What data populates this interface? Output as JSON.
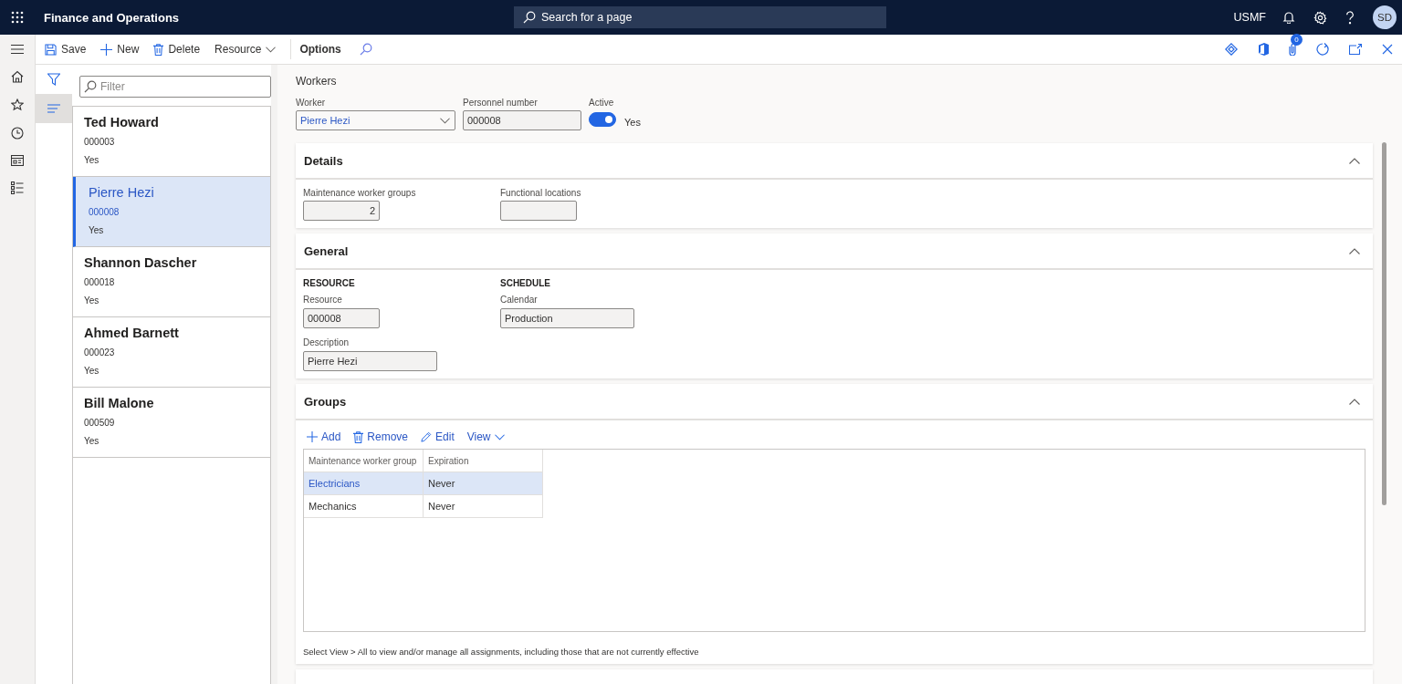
{
  "app": {
    "title": "Finance and Operations",
    "search_placeholder": "Search for a page",
    "company": "USMF",
    "avatar": "SD",
    "notification_count": "0"
  },
  "action_bar": [
    {
      "label": "Save",
      "kind": "save"
    },
    {
      "label": "New",
      "kind": "new"
    },
    {
      "label": "Delete",
      "kind": "delete"
    },
    {
      "label": "Resource",
      "kind": "menu"
    },
    {
      "label": "Options",
      "kind": "strong"
    },
    {
      "kind": "search"
    }
  ],
  "list": {
    "filter_placeholder": "Filter",
    "items": [
      {
        "name": "Ted Howard",
        "number": "000003",
        "active": "Yes",
        "selected": false
      },
      {
        "name": "Pierre Hezi",
        "number": "000008",
        "active": "Yes",
        "selected": true
      },
      {
        "name": "Shannon Dascher",
        "number": "000018",
        "active": "Yes",
        "selected": false
      },
      {
        "name": "Ahmed Barnett",
        "number": "000023",
        "active": "Yes",
        "selected": false
      },
      {
        "name": "Bill Malone",
        "number": "000509",
        "active": "Yes",
        "selected": false
      }
    ]
  },
  "header": {
    "title": "Workers",
    "worker": {
      "label": "Worker",
      "value": "Pierre Hezi"
    },
    "personnel_number": {
      "label": "Personnel number",
      "value": "000008"
    },
    "active": {
      "label": "Active",
      "on": true,
      "text": "Yes"
    }
  },
  "sections": [
    {
      "kind": "details",
      "title": "Details",
      "expanded": true,
      "fields": [
        {
          "label": "Maintenance worker groups",
          "value": "2",
          "kind": "number"
        },
        {
          "label": "Functional locations",
          "kind": "code"
        }
      ]
    },
    {
      "kind": "general",
      "title": "General",
      "expanded": true,
      "groups": [
        {
          "heading": "RESOURCE",
          "fields": [
            {
              "label": "Resource",
              "value": "000008",
              "kind": "code"
            },
            {
              "label": "Description",
              "value": "Pierre Hezi",
              "kind": "text"
            }
          ]
        },
        {
          "heading": "SCHEDULE",
          "fields": [
            {
              "label": "Calendar",
              "value": "Production",
              "kind": "text"
            }
          ]
        }
      ]
    },
    {
      "kind": "groups",
      "title": "Groups",
      "expanded": true,
      "toolbar": [
        {
          "label": "Add",
          "kind": "add"
        },
        {
          "label": "Remove",
          "kind": "delete"
        },
        {
          "label": "Edit",
          "kind": "edit"
        },
        {
          "label": "View",
          "kind": "menu"
        }
      ],
      "columns": [
        "Maintenance worker group",
        "Expiration"
      ],
      "rows": [
        {
          "cells": [
            "Electricians",
            "Never"
          ],
          "selected": true
        },
        {
          "cells": [
            "Mechanics",
            "Never"
          ],
          "selected": false
        }
      ],
      "note": "Select View > All to view and/or manage all assignments, including those that are not currently effective"
    }
  ]
}
